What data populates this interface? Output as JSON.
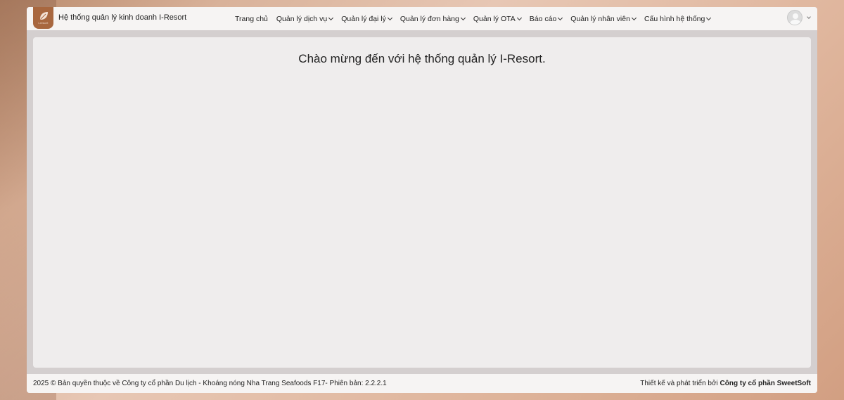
{
  "navbar": {
    "logo_text": "i-resort",
    "brand_title": "Hệ thống quản lý kinh doanh I-Resort",
    "menu": [
      {
        "label": "Trang chủ",
        "has_dropdown": false
      },
      {
        "label": "Quản lý dịch vụ",
        "has_dropdown": true
      },
      {
        "label": "Quản lý đại lý",
        "has_dropdown": true
      },
      {
        "label": "Quản lý đơn hàng",
        "has_dropdown": true
      },
      {
        "label": "Quản lý OTA",
        "has_dropdown": true
      },
      {
        "label": "Báo cáo",
        "has_dropdown": true
      },
      {
        "label": "Quản lý nhân viên",
        "has_dropdown": true
      },
      {
        "label": "Cấu hình hệ thống",
        "has_dropdown": true
      }
    ],
    "user_icon": "user-avatar-icon"
  },
  "main": {
    "welcome_text": "Chào mừng đến với hệ thống quản lý I-Resort."
  },
  "footer": {
    "copyright": "2025 © Bản quyền thuộc về Công ty cổ phần Du lịch - Khoáng nóng Nha Trang Seafoods F17- Phiên bản: 2.2.2.1",
    "designed_by_prefix": "Thiết kế và phát triển bởi",
    "designed_by_company": "Công ty cổ phần SweetSoft"
  },
  "colors": {
    "logo_bg": "#a8673f",
    "navbar_bg": "#f6f4f3",
    "content_bg": "#efeded"
  }
}
